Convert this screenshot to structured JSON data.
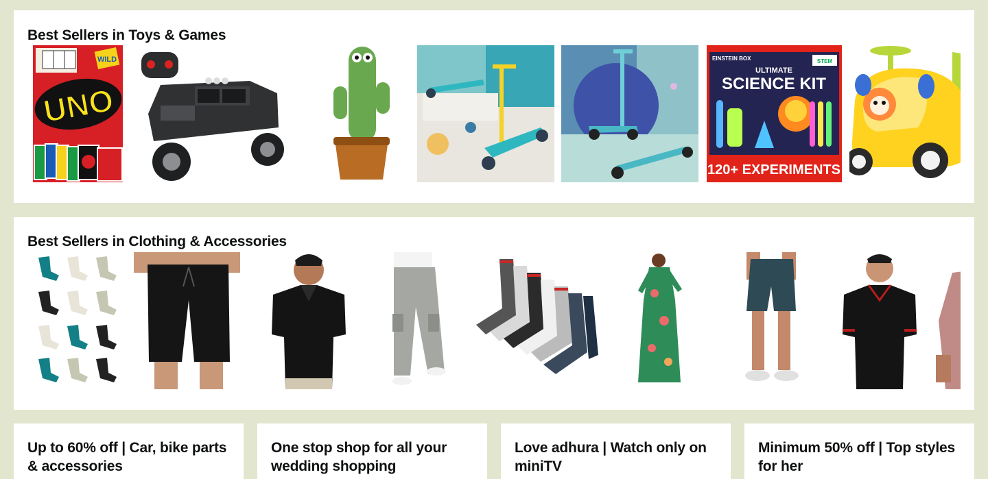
{
  "toys": {
    "title": "Best Sellers in Toys & Games",
    "items": [
      {
        "name": "UNO card game",
        "brand_text": "UNO",
        "badge": "WILD"
      },
      {
        "name": "Remote control monster truck"
      },
      {
        "name": "Dancing cactus toy"
      },
      {
        "name": "Kids scooter teal"
      },
      {
        "name": "Kids scooter blue"
      },
      {
        "name": "Science kit",
        "brand": "EINSTEIN BOX",
        "heading_small": "ULTIMATE",
        "heading": "SCIENCE KIT",
        "footer": "120+ EXPERIMENTS",
        "tag": "STEM"
      },
      {
        "name": "Ride-on toy car yellow"
      }
    ]
  },
  "clothing": {
    "title": "Best Sellers in Clothing & Accessories",
    "items": [
      {
        "name": "Ankle socks pack"
      },
      {
        "name": "Black shorts"
      },
      {
        "name": "Black polo t-shirt"
      },
      {
        "name": "Grey cargo pants"
      },
      {
        "name": "Sports socks pack"
      },
      {
        "name": "Floral maxi dress"
      },
      {
        "name": "Teal shorts"
      },
      {
        "name": "Black polo t-shirt tipped"
      },
      {
        "name": "Pink shirt partial"
      }
    ]
  },
  "cards": [
    {
      "title": "Up to 60% off | Car, bike parts & accessories"
    },
    {
      "title": "One stop shop for all your wedding shopping"
    },
    {
      "title": "Love adhura | Watch only on miniTV"
    },
    {
      "title": "Minimum 50% off | Top styles for her"
    }
  ],
  "colors": {
    "background": "#e3e6cf",
    "panel": "#ffffff",
    "text": "#0f1111"
  }
}
